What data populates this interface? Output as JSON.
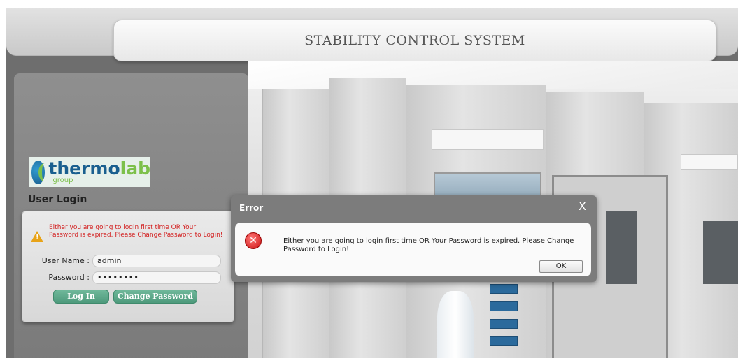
{
  "header": {
    "title": "STABILITY CONTROL SYSTEM"
  },
  "logo": {
    "main_a": "thermo",
    "main_b": "lab",
    "sub": "group"
  },
  "login": {
    "heading": "User Login",
    "warning": "Either you are going to login first time OR Your Password is expired. Please Change Password to Login!",
    "username_label": "User Name :",
    "username_value": "admin",
    "password_label": "Password :",
    "password_value": "••••••••",
    "login_button": "Log In",
    "change_password_button": "Change Password"
  },
  "dialog": {
    "title": "Error",
    "close": "X",
    "message": "Either you are going to login first time OR Your Password is expired. Please Change Password to Login!",
    "ok_button": "OK"
  },
  "colors": {
    "accent_green": "#5aa688",
    "warning_red": "#d32020",
    "dialog_bar": "#7c7c7c"
  }
}
